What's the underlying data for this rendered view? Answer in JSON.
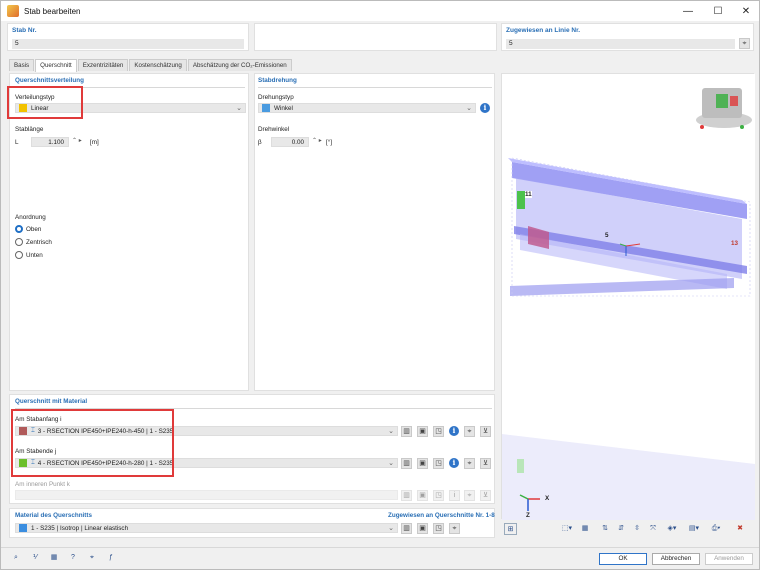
{
  "window": {
    "title": "Stab bearbeiten",
    "minimize": "—",
    "maximize": "☐",
    "close": "✕"
  },
  "header": {
    "member_label": "Stab Nr.",
    "member_value": "5",
    "line_label": "Zugewiesen an Linie Nr.",
    "line_value": "5"
  },
  "tabs": [
    "Basis",
    "Querschnitt",
    "Exzentrizitäten",
    "Kostenschätzung",
    "Abschätzung der CO₂-Emissionen"
  ],
  "distribution": {
    "section_title": "Querschnittsverteilung",
    "type_label": "Verteilungstyp",
    "type_value": "Linear",
    "type_color": "#f2c200",
    "length_label": "Stablänge",
    "length_symbol": "L",
    "length_value": "1.100",
    "length_unit": "[m]",
    "arrangement_label": "Anordnung",
    "options": [
      "Oben",
      "Zentrisch",
      "Unten"
    ],
    "selected_option": "Oben"
  },
  "rotation": {
    "section_title": "Stabdrehung",
    "type_label": "Drehungstyp",
    "type_value": "Winkel",
    "type_color": "#4a9be0",
    "angle_label": "Drehwinkel",
    "angle_symbol": "β",
    "angle_value": "0.00",
    "angle_unit": "[°]"
  },
  "sections": {
    "section_title": "Querschnitt mit Material",
    "start_label": "Am Stabanfang i",
    "start_value": "3 - RSECTION IPE450+IPE240-h-450 | 1 - S235",
    "start_color": "#b05a5a",
    "end_label": "Am Stabende j",
    "end_value": "4 - RSECTION IPE450+IPE240-h-280 | 1 - S235",
    "end_color": "#6bbf2a",
    "inner_label": "Am inneren Punkt k"
  },
  "material": {
    "section_title": "Material des Querschnitts",
    "assigned_label": "Zugewiesen an Querschnitte Nr. 1-8",
    "value": "1 - S235 | Isotrop | Linear elastisch",
    "color": "#3b8ee0"
  },
  "viewport": {
    "labels": {
      "node_11": "11",
      "member_5": "5",
      "node_13": "13"
    },
    "axis_x": "X",
    "axis_z": "Z"
  },
  "footer": {
    "ok": "OK",
    "cancel": "Abbrechen",
    "apply": "Anwenden"
  }
}
